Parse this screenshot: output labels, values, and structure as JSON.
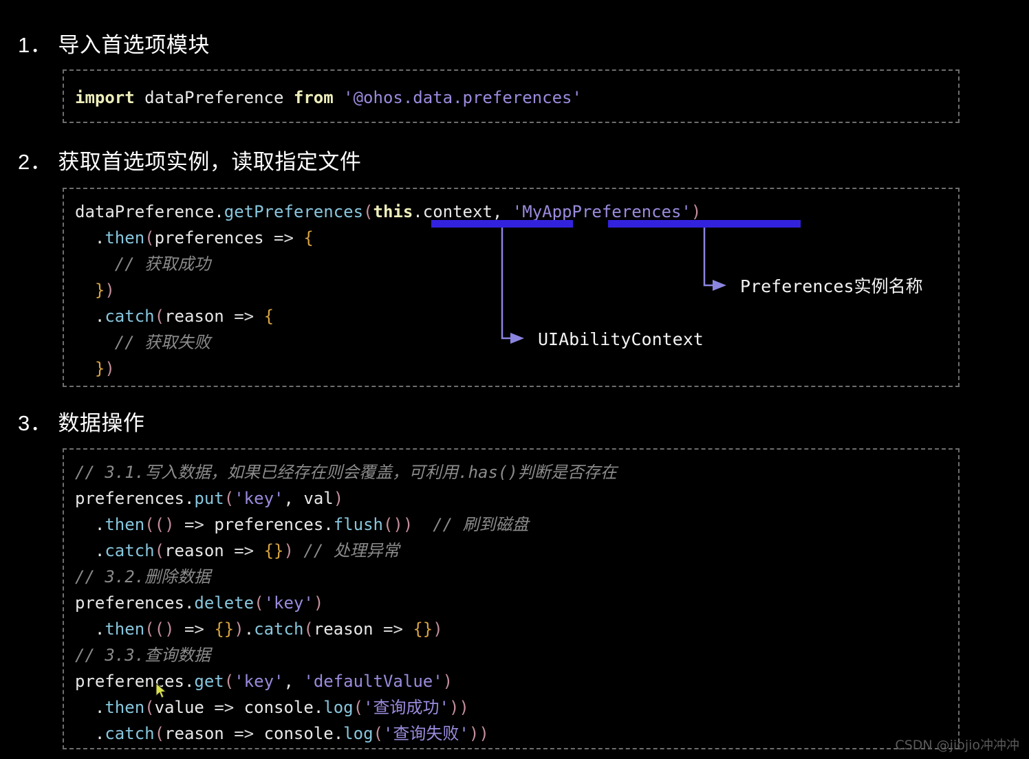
{
  "page": {
    "background": "#000000",
    "watermark": "CSDN @jiojio冲冲冲"
  },
  "sections": [
    {
      "heading": "1． 导入首选项模块"
    },
    {
      "heading": "2． 获取首选项实例，读取指定文件"
    },
    {
      "heading": "3． 数据操作"
    }
  ],
  "code_blocks": {
    "block1": {
      "lines": [
        {
          "tokens": [
            {
              "text": "import",
              "type": "keyword"
            },
            {
              "text": " dataPreference ",
              "type": "plain"
            },
            {
              "text": "from",
              "type": "keyword"
            },
            {
              "text": " ",
              "type": "plain"
            },
            {
              "text": "'@ohos.data.preferences'",
              "type": "string"
            }
          ]
        }
      ]
    },
    "block2": {
      "lines": [
        {
          "tokens": [
            {
              "text": "dataPreference",
              "type": "plain"
            },
            {
              "text": ".",
              "type": "plain"
            },
            {
              "text": "getPreferences",
              "type": "function"
            },
            {
              "text": "(",
              "type": "punct"
            },
            {
              "text": "this",
              "type": "keyword"
            },
            {
              "text": ".context",
              "type": "plain"
            },
            {
              "text": ", ",
              "type": "plain"
            },
            {
              "text": "'MyAppPreferences'",
              "type": "string"
            },
            {
              "text": ")",
              "type": "punct"
            }
          ]
        },
        {
          "tokens": [
            {
              "text": "  .",
              "type": "plain"
            },
            {
              "text": "then",
              "type": "function"
            },
            {
              "text": "(",
              "type": "punct"
            },
            {
              "text": "preferences ",
              "type": "plain"
            },
            {
              "text": "=>",
              "type": "operator"
            },
            {
              "text": " ",
              "type": "plain"
            },
            {
              "text": "{",
              "type": "brace"
            }
          ]
        },
        {
          "tokens": [
            {
              "text": "    // 获取成功",
              "type": "comment"
            }
          ]
        },
        {
          "tokens": [
            {
              "text": "  ",
              "type": "plain"
            },
            {
              "text": "}",
              "type": "brace"
            },
            {
              "text": ")",
              "type": "punct"
            }
          ]
        },
        {
          "tokens": [
            {
              "text": "  .",
              "type": "plain"
            },
            {
              "text": "catch",
              "type": "function"
            },
            {
              "text": "(",
              "type": "punct"
            },
            {
              "text": "reason ",
              "type": "plain"
            },
            {
              "text": "=>",
              "type": "operator"
            },
            {
              "text": " ",
              "type": "plain"
            },
            {
              "text": "{",
              "type": "brace"
            }
          ]
        },
        {
          "tokens": [
            {
              "text": "    // 获取失败",
              "type": "comment"
            }
          ]
        },
        {
          "tokens": [
            {
              "text": "  ",
              "type": "plain"
            },
            {
              "text": "}",
              "type": "brace"
            },
            {
              "text": ")",
              "type": "punct"
            }
          ]
        }
      ]
    },
    "block3": {
      "lines": [
        {
          "tokens": [
            {
              "text": "// 3.1.写入数据，如果已经存在则会覆盖，可利用.has()判断是否存在",
              "type": "comment"
            }
          ]
        },
        {
          "tokens": [
            {
              "text": "preferences",
              "type": "plain"
            },
            {
              "text": ".",
              "type": "plain"
            },
            {
              "text": "put",
              "type": "function"
            },
            {
              "text": "(",
              "type": "punct"
            },
            {
              "text": "'key'",
              "type": "string"
            },
            {
              "text": ", val",
              "type": "plain"
            },
            {
              "text": ")",
              "type": "punct"
            }
          ]
        },
        {
          "tokens": [
            {
              "text": "  .",
              "type": "plain"
            },
            {
              "text": "then",
              "type": "function"
            },
            {
              "text": "((",
              "type": "punct"
            },
            {
              "text": ")",
              "type": "punct"
            },
            {
              "text": " ",
              "type": "plain"
            },
            {
              "text": "=>",
              "type": "operator"
            },
            {
              "text": " preferences",
              "type": "plain"
            },
            {
              "text": ".",
              "type": "plain"
            },
            {
              "text": "flush",
              "type": "function"
            },
            {
              "text": "())",
              "type": "punct"
            },
            {
              "text": "  ",
              "type": "plain"
            },
            {
              "text": "// 刷到磁盘",
              "type": "comment"
            }
          ]
        },
        {
          "tokens": [
            {
              "text": "  .",
              "type": "plain"
            },
            {
              "text": "catch",
              "type": "function"
            },
            {
              "text": "(",
              "type": "punct"
            },
            {
              "text": "reason ",
              "type": "plain"
            },
            {
              "text": "=>",
              "type": "operator"
            },
            {
              "text": " ",
              "type": "plain"
            },
            {
              "text": "{}",
              "type": "brace"
            },
            {
              "text": ")",
              "type": "punct"
            },
            {
              "text": " ",
              "type": "plain"
            },
            {
              "text": "// 处理异常",
              "type": "comment"
            }
          ]
        },
        {
          "tokens": [
            {
              "text": "// 3.2.删除数据",
              "type": "comment"
            }
          ]
        },
        {
          "tokens": [
            {
              "text": "preferences",
              "type": "plain"
            },
            {
              "text": ".",
              "type": "plain"
            },
            {
              "text": "delete",
              "type": "function"
            },
            {
              "text": "(",
              "type": "punct"
            },
            {
              "text": "'key'",
              "type": "string"
            },
            {
              "text": ")",
              "type": "punct"
            }
          ]
        },
        {
          "tokens": [
            {
              "text": "  .",
              "type": "plain"
            },
            {
              "text": "then",
              "type": "function"
            },
            {
              "text": "((",
              "type": "punct"
            },
            {
              "text": ")",
              "type": "punct"
            },
            {
              "text": " ",
              "type": "plain"
            },
            {
              "text": "=>",
              "type": "operator"
            },
            {
              "text": " ",
              "type": "plain"
            },
            {
              "text": "{}",
              "type": "brace"
            },
            {
              "text": ")",
              "type": "punct"
            },
            {
              "text": ".",
              "type": "plain"
            },
            {
              "text": "catch",
              "type": "function"
            },
            {
              "text": "(",
              "type": "punct"
            },
            {
              "text": "reason ",
              "type": "plain"
            },
            {
              "text": "=>",
              "type": "operator"
            },
            {
              "text": " ",
              "type": "plain"
            },
            {
              "text": "{}",
              "type": "brace"
            },
            {
              "text": ")",
              "type": "punct"
            }
          ]
        },
        {
          "tokens": [
            {
              "text": "// 3.3.查询数据",
              "type": "comment"
            }
          ]
        },
        {
          "tokens": [
            {
              "text": "preferences",
              "type": "plain"
            },
            {
              "text": ".",
              "type": "plain"
            },
            {
              "text": "get",
              "type": "function"
            },
            {
              "text": "(",
              "type": "punct"
            },
            {
              "text": "'key'",
              "type": "string"
            },
            {
              "text": ", ",
              "type": "plain"
            },
            {
              "text": "'defaultValue'",
              "type": "string"
            },
            {
              "text": ")",
              "type": "punct"
            }
          ]
        },
        {
          "tokens": [
            {
              "text": "  .",
              "type": "plain"
            },
            {
              "text": "then",
              "type": "function"
            },
            {
              "text": "(",
              "type": "punct"
            },
            {
              "text": "value ",
              "type": "plain"
            },
            {
              "text": "=>",
              "type": "operator"
            },
            {
              "text": " console",
              "type": "plain"
            },
            {
              "text": ".",
              "type": "plain"
            },
            {
              "text": "log",
              "type": "function"
            },
            {
              "text": "(",
              "type": "punct"
            },
            {
              "text": "'查询成功'",
              "type": "string"
            },
            {
              "text": "))",
              "type": "punct"
            }
          ]
        },
        {
          "tokens": [
            {
              "text": "  .",
              "type": "plain"
            },
            {
              "text": "catch",
              "type": "function"
            },
            {
              "text": "(",
              "type": "punct"
            },
            {
              "text": "reason ",
              "type": "plain"
            },
            {
              "text": "=>",
              "type": "operator"
            },
            {
              "text": " console",
              "type": "plain"
            },
            {
              "text": ".",
              "type": "plain"
            },
            {
              "text": "log",
              "type": "function"
            },
            {
              "text": "(",
              "type": "punct"
            },
            {
              "text": "'查询失败'",
              "type": "string"
            },
            {
              "text": "))",
              "type": "punct"
            }
          ]
        }
      ]
    }
  },
  "annotations": {
    "highlight_color": "#3322dd",
    "connector_color": "#8b85e0",
    "items": [
      {
        "label": "UIAbilityContext",
        "target": "this.context"
      },
      {
        "label": "Preferences实例名称",
        "target": "'MyAppPreferences'"
      }
    ]
  },
  "colors": {
    "background": "#000000",
    "heading_text": "#ffffff",
    "code_border": "#6e6e6e",
    "keyword": "#eeeebb",
    "string": "#9b8bdd",
    "function": "#88c6dd",
    "punct": "#c48f9c",
    "brace": "#d9a441",
    "comment": "#8b8b8b",
    "plain": "#e8e8e8",
    "annotation_highlight": "#3322dd",
    "annotation_connector": "#8b85e0",
    "watermark": "#5a5a5a",
    "cursor": "#d8e04a"
  }
}
